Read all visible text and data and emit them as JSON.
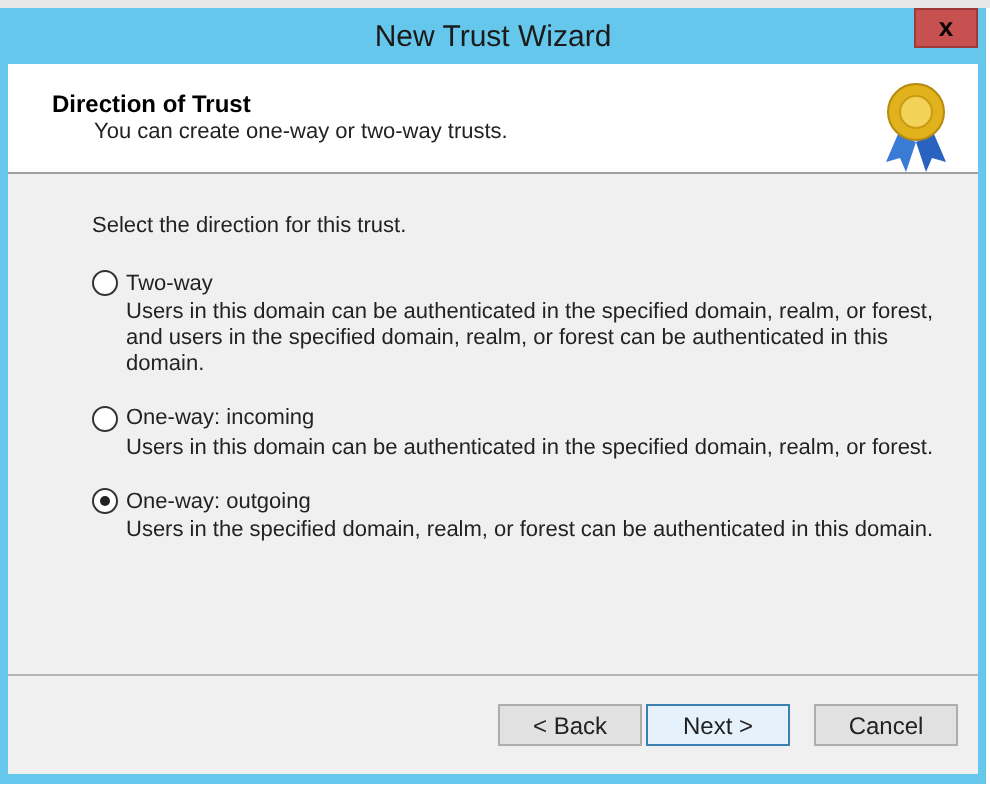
{
  "window": {
    "title": "New Trust Wizard",
    "close": "x"
  },
  "header": {
    "title": "Direction of Trust",
    "subtitle": "You can create one-way or two-way trusts."
  },
  "prompt": "Select the direction for this trust.",
  "options": [
    {
      "label": "Two-way",
      "description": "Users in this domain can be authenticated in the specified domain, realm, or forest, and users in the specified domain, realm, or forest can be authenticated in this domain.",
      "selected": false
    },
    {
      "label": "One-way: incoming",
      "description": "Users in this domain can be authenticated in the specified domain, realm, or forest.",
      "selected": false
    },
    {
      "label": "One-way: outgoing",
      "description": "Users in the specified domain, realm, or forest can be authenticated in this domain.",
      "selected": true
    }
  ],
  "buttons": [
    {
      "label": "< Back",
      "default": false
    },
    {
      "label": "Next >",
      "default": true
    },
    {
      "label": "Cancel",
      "default": false
    }
  ]
}
